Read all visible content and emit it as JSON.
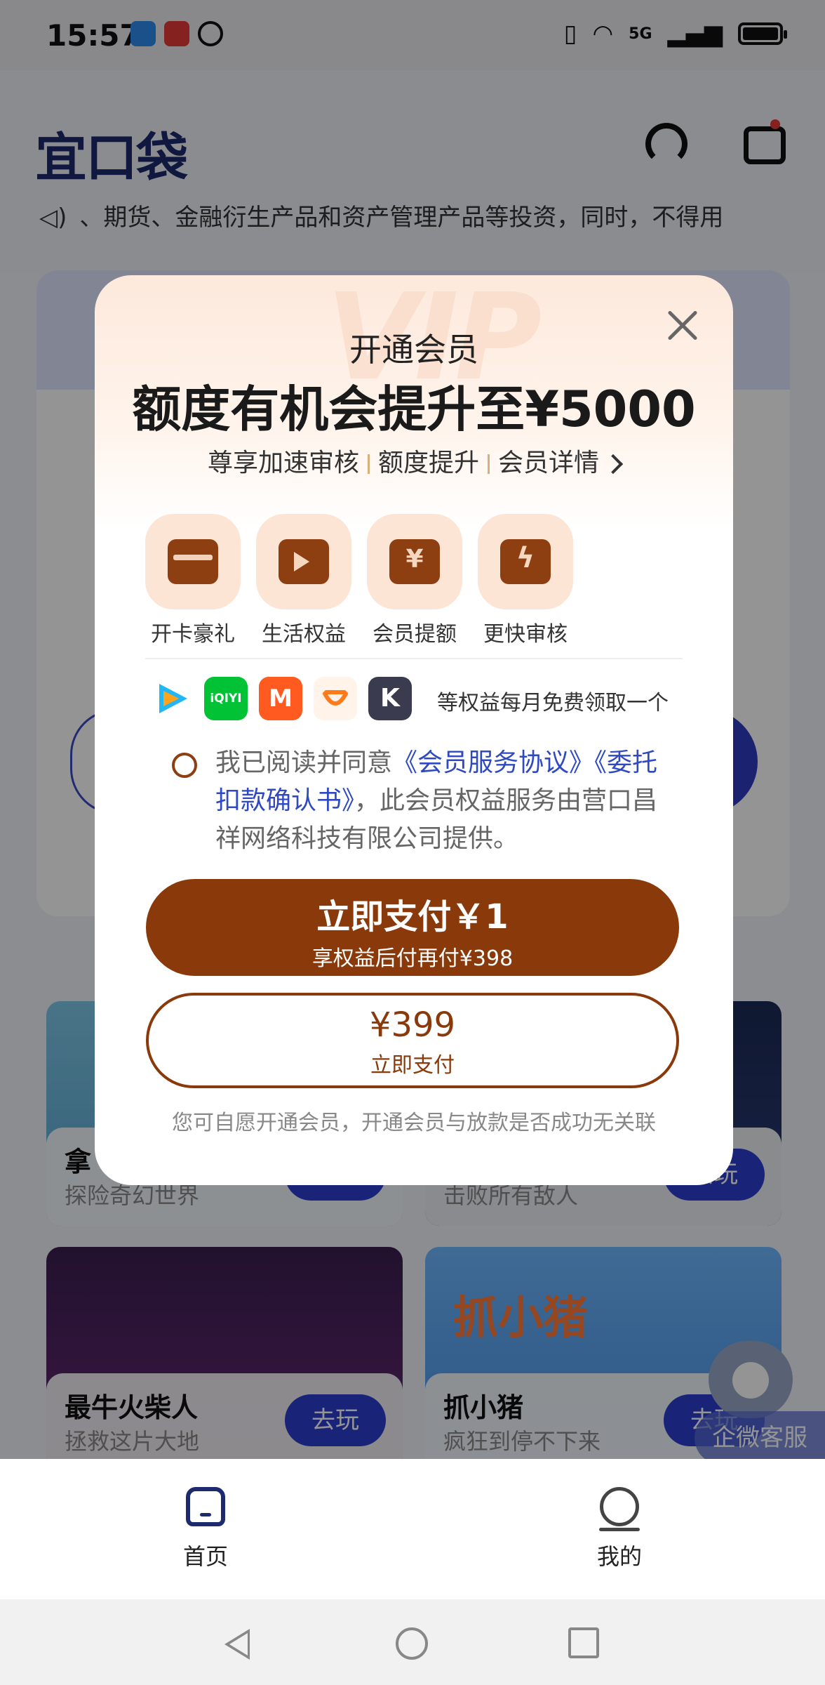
{
  "status_bar": {
    "time": "15:57",
    "network": "5G"
  },
  "app": {
    "logo": "宜口袋",
    "marquee": "、期货、金融衍生产品和资产管理产品等投资，同时，不得用"
  },
  "games": [
    {
      "title": "拿",
      "subtitle": "探险奇幻世界",
      "button": "去玩"
    },
    {
      "title": "",
      "subtitle": "击败所有敌人",
      "button": "去玩"
    },
    {
      "title": "最牛火柴人",
      "subtitle": "拯救这片大地",
      "button": "去玩"
    },
    {
      "title": "抓小猪",
      "subtitle": "疯狂到停不下来",
      "button": "去玩",
      "banner": "抓小猪"
    }
  ],
  "kefu_label": "企微客服",
  "bottom_nav": [
    {
      "label": "首页"
    },
    {
      "label": "我的"
    }
  ],
  "modal": {
    "watermark": "VIP",
    "title": "开通会员",
    "headline": "额度有机会提升至¥5000",
    "perks": [
      "尊享加速审核",
      "额度提升",
      "会员详情"
    ],
    "benefits": [
      {
        "label": "开卡豪礼",
        "icon": "card-icon"
      },
      {
        "label": "生活权益",
        "icon": "video-icon"
      },
      {
        "label": "会员提额",
        "icon": "yen-ticket-icon"
      },
      {
        "label": "更快审核",
        "icon": "fast-review-icon"
      }
    ],
    "apps": [
      {
        "name": "tencent-video-icon",
        "text": ""
      },
      {
        "name": "iqiyi-icon",
        "text": "iQIYI"
      },
      {
        "name": "mango-tv-icon",
        "text": "M"
      },
      {
        "name": "didi-icon",
        "text": ""
      },
      {
        "name": "k-app-icon",
        "text": "K"
      }
    ],
    "apps_text": "等权益每月免费领取一个",
    "agree_prefix": "我已阅读并同意",
    "agree_link1": "《会员服务协议》",
    "agree_link2": "《委托扣款确认书》",
    "agree_suffix": "，此会员权益服务由营口昌祥网络科技有限公司提供。",
    "pay_main": "立即支付￥1",
    "pay_sub": "享权益后付再付¥398",
    "pay2_main": "¥399",
    "pay2_sub": "立即支付",
    "disclaimer": "您可自愿开通会员，开通会员与放款是否成功无关联"
  },
  "colors": {
    "brand": "#8a3a0a",
    "link": "#2f49c2",
    "nav": "#1e2a6e"
  }
}
